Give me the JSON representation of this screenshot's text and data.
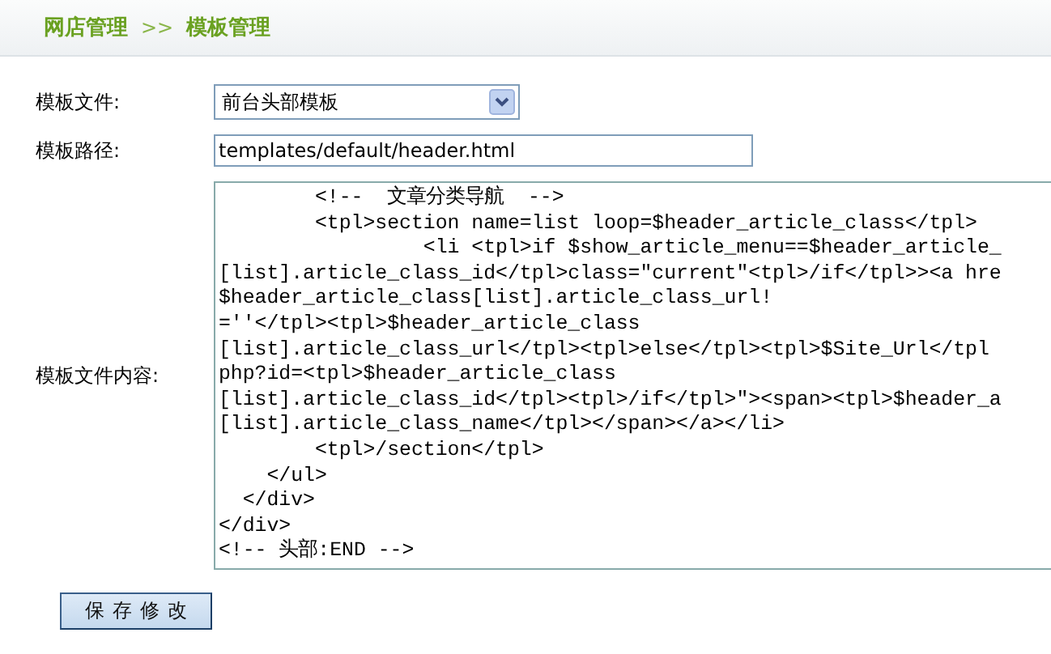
{
  "breadcrumb": {
    "section": "网店管理",
    "separator": ">>",
    "page": "模板管理"
  },
  "fields": [
    {
      "kind": "select",
      "label": "模板文件:",
      "value": "前台头部模板"
    },
    {
      "kind": "input",
      "label": "模板路径:",
      "value": "templates/default/header.html"
    },
    {
      "kind": "code",
      "label": "模板文件内容:",
      "lines": [
        "        <!--  文章分类导航  -->",
        "        <tpl>section name=list loop=$header_article_class</tpl>",
        "                 <li <tpl>if $show_article_menu==$header_article_",
        "[list].article_class_id</tpl>class=\"current\"<tpl>/if</tpl>><a hre",
        "$header_article_class[list].article_class_url!",
        "=''</tpl><tpl>$header_article_class",
        "[list].article_class_url</tpl><tpl>else</tpl><tpl>$Site_Url</tpl",
        "php?id=<tpl>$header_article_class",
        "[list].article_class_id</tpl><tpl>/if</tpl>\"><span><tpl>$header_a",
        "[list].article_class_name</tpl></span></a></li>",
        "        <tpl>/section</tpl>",
        "    </ul>",
        "  </div>",
        "</div>",
        "<!-- 头部:END -->"
      ]
    }
  ],
  "buttons": [
    "保存修改"
  ]
}
